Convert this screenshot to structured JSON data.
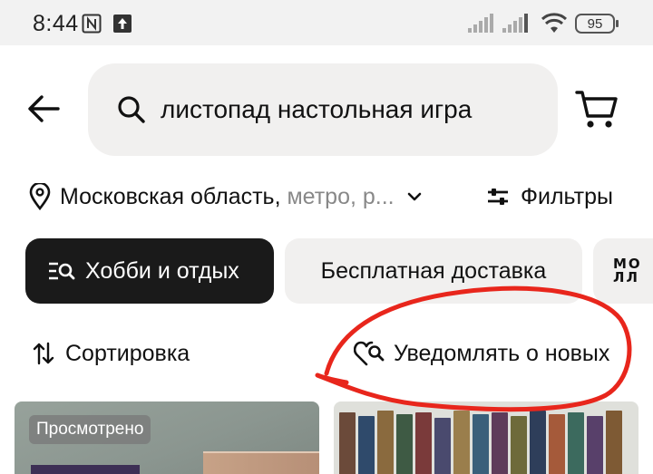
{
  "status_bar": {
    "time": "8:44",
    "battery": "95",
    "icons": [
      "nfc-icon",
      "upload-icon",
      "signal-icon",
      "signal-icon",
      "wifi-icon",
      "battery-icon"
    ]
  },
  "header": {
    "search_query": "листопад настольная игра",
    "icons": [
      "back-arrow-icon",
      "search-icon",
      "cart-icon"
    ]
  },
  "location": {
    "main": "Московская область, ",
    "sub": "метро, р...",
    "icons": [
      "location-pin-icon",
      "chevron-down-icon"
    ]
  },
  "filters": {
    "label": "Фильтры",
    "icon": "sliders-icon"
  },
  "chips": [
    {
      "label": "Хобби и отдых",
      "icon": "category-search-icon",
      "selected": true
    },
    {
      "label": "Бесплатная доставка",
      "selected": false
    },
    {
      "logo": "МО ЛЛ"
    }
  ],
  "sort": {
    "label": "Сортировка",
    "icon": "sort-arrows-icon"
  },
  "notify": {
    "label": "Уведомлять о новых",
    "icon": "heart-search-icon"
  },
  "products": [
    {
      "badge": "Просмотрено"
    },
    {}
  ],
  "colors": {
    "chip_selected_bg": "#1a1a1a",
    "chip_bg": "#f1f0ef",
    "search_bg": "#f1f0ef",
    "annotation_red": "#e8261c"
  }
}
